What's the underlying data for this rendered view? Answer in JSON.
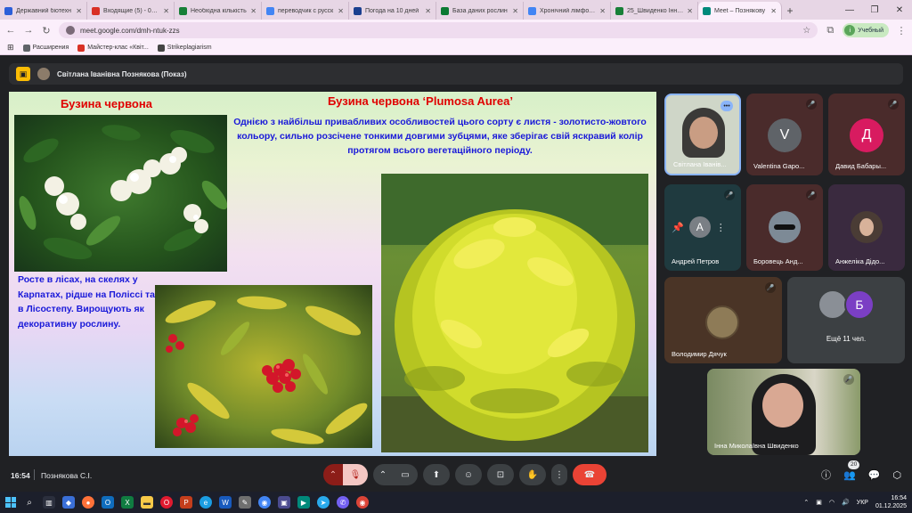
{
  "browser": {
    "tabs": [
      {
        "title": "Державний біотехн",
        "color": "#2b5fd9"
      },
      {
        "title": "Входящие (5) - 0508",
        "color": "#d93025"
      },
      {
        "title": "Необхідна кількість",
        "color": "#188038"
      },
      {
        "title": "переводчик с русск",
        "color": "#4285f4"
      },
      {
        "title": "Погода на 10 дней",
        "color": "#1a3f8f"
      },
      {
        "title": "База даних рослин",
        "color": "#0b7a33"
      },
      {
        "title": "Хронічний лімфоїдн",
        "color": "#4285f4"
      },
      {
        "title": "25_Швиденко Інна Н",
        "color": "#188038"
      },
      {
        "title": "Meet – Познякову",
        "color": "#00897b"
      }
    ],
    "url": "meet.google.com/dmh-ntuk-zzs",
    "profile_label": "Учебный",
    "bookmarks": [
      {
        "label": "Расширения",
        "color": "#5f6368"
      },
      {
        "label": "Майстер-клас «Квіт...",
        "color": "#d93025"
      },
      {
        "label": "Strikeplagiarism",
        "color": "#444"
      }
    ]
  },
  "meet": {
    "presenter_label": "Світлана Іванівна Познякова (Показ)",
    "slide": {
      "title_left": "Бузина червона",
      "title_right": "Бузина червона ‘Plumosa Aurea’",
      "description": "Однією з найбільш привабливих особливостей цього сорту є листя - золотисто-жовтого кольору, сильно розсічене тонкими довгими зубцями,  яке зберігає свій яскравий колір протягом всього вегетаційного періоду.",
      "note": "Росте в лісах, на скелях у Карпатах, рідше на Поліссі та в Лісостепу. Вирощують як декоративну рослину."
    },
    "participants": [
      {
        "name": "Світлана Іванів...",
        "initial": "",
        "color": "#cfd6c8"
      },
      {
        "name": "Valentina Gapo...",
        "initial": "V",
        "color": "#5f6368"
      },
      {
        "name": "Давид Бабары...",
        "initial": "Д",
        "color": "#d81b60"
      },
      {
        "name": "Андрей Петров",
        "initial": "А",
        "color": "#7a7f85"
      },
      {
        "name": "Боровець Анд...",
        "initial": "",
        "color": "#7d8a96"
      },
      {
        "name": "Анжеліка Дідо...",
        "initial": "",
        "color": "#4a3c35"
      },
      {
        "name": "Володимир Дячук",
        "initial": "",
        "color": "#8e7b57"
      },
      {
        "name": "Інна Миколаївна Швиденко",
        "initial": "",
        "color": "#5a6a50"
      }
    ],
    "more": {
      "label": "Ещё 11 чел.",
      "initial": "Б",
      "color": "#7b3fc4"
    },
    "clock": "16:54",
    "meeting_title": "Познякова С.І.",
    "people_count": "20"
  },
  "taskbar": {
    "lang": "УКР",
    "time": "16:54",
    "date": "01.12.2025"
  }
}
